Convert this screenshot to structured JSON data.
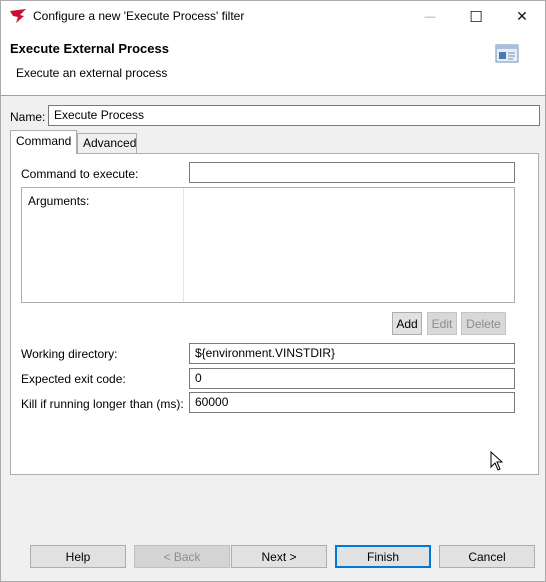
{
  "window": {
    "title": "Configure a new 'Execute Process' filter",
    "minimize_glyph": "—",
    "maximize_glyph": "☐",
    "close_glyph": "✕"
  },
  "header": {
    "title": "Execute External Process",
    "subtitle": "Execute an external process"
  },
  "name_field": {
    "label": "Name:",
    "value": "Execute Process"
  },
  "tabs": [
    {
      "label": "Command",
      "active": true
    },
    {
      "label": "Advanced",
      "active": false
    }
  ],
  "command": {
    "command_label": "Command to execute:",
    "command_value": "",
    "arguments_label": "Arguments:",
    "add_label": "Add",
    "edit_label": "Edit",
    "delete_label": "Delete",
    "working_dir_label": "Working directory:",
    "working_dir_value": "${environment.VINSTDIR}",
    "exit_code_label": "Expected exit code:",
    "exit_code_value": "0",
    "timeout_label": "Kill if running longer than (ms):",
    "timeout_value": "60000"
  },
  "buttons": {
    "help": "Help",
    "back": "< Back",
    "next": "Next >",
    "finish": "Finish",
    "cancel": "Cancel"
  },
  "colors": {
    "accent": "#0078d7",
    "app_icon": "#c8102e"
  }
}
